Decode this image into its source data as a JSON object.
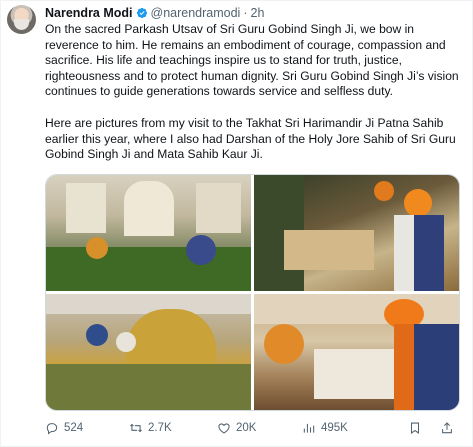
{
  "author": {
    "name": "Narendra Modi",
    "handle": "@narendramodi",
    "separator": "·",
    "time": "2h"
  },
  "tweet": {
    "paragraph1": "On the sacred Parkash Utsav of Sri Guru Gobind Singh Ji, we bow in reverence to him. He remains an embodiment of courage, compassion and sacrifice. His life and teachings inspire us to stand for truth, justice, righteousness and to protect human dignity. Sri Guru Gobind Singh Ji’s vision continues to guide generations towards service and selfless duty.",
    "paragraph2": "Here are pictures from my visit to the Takhat Sri Harimandir Ji Patna Sahib earlier this year, where I also had Darshan of the Holy Jore Sahib of Sri Guru Gobind Singh Ji and Mata Sahib Kaur Ji."
  },
  "icons": {
    "verified": "verified-badge-icon",
    "reply": "reply-icon",
    "repost": "repost-icon",
    "like": "like-icon",
    "views": "views-icon",
    "bookmark": "bookmark-icon",
    "share": "share-icon"
  },
  "actions": {
    "replies": "524",
    "reposts": "2.7K",
    "likes": "20K",
    "views": "495K"
  },
  "colors": {
    "text": "#0f1419",
    "secondary": "#536471",
    "verified": "#1d9bf0",
    "border": "#cfd9de"
  }
}
